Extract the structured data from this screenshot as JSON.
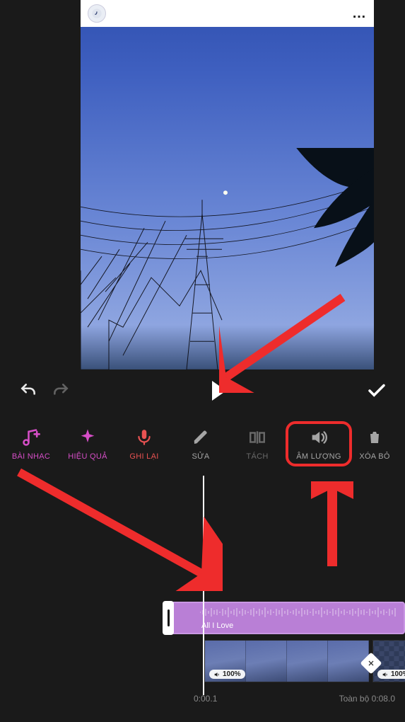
{
  "preview": {
    "more_glyph": "…"
  },
  "controls": {
    "undo": "undo",
    "redo": "redo",
    "play": "play",
    "confirm": "confirm"
  },
  "toolbar": {
    "items": [
      {
        "id": "music",
        "label": "BÀI NHẠC",
        "icon": "music-plus"
      },
      {
        "id": "effects",
        "label": "HIỆU QUẢ",
        "icon": "sparkle"
      },
      {
        "id": "record",
        "label": "GHI LẠI",
        "icon": "mic"
      },
      {
        "id": "edit",
        "label": "SỬA",
        "icon": "pencil"
      },
      {
        "id": "split",
        "label": "TÁCH",
        "icon": "split"
      },
      {
        "id": "volume",
        "label": "ÂM LƯỢNG",
        "icon": "speaker"
      },
      {
        "id": "delete",
        "label": "XÓA BỎ",
        "icon": "trash"
      }
    ]
  },
  "timeline": {
    "music_track": {
      "title": "All I Love"
    },
    "video_clips": [
      {
        "volume_label": "100%"
      },
      {
        "volume_label": "100%"
      }
    ],
    "current_time": "0:00.1",
    "total_label_prefix": "Toàn bộ",
    "total_time": "0:08.0"
  },
  "annotations": {
    "arrow_to_play": true,
    "arrow_to_timeline": true,
    "arrow_to_volume": true,
    "highlight": "volume"
  }
}
